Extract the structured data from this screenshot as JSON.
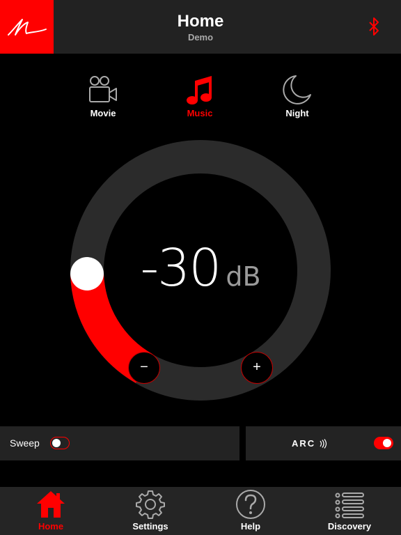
{
  "header": {
    "title": "Home",
    "subtitle": "Demo",
    "logo_icon": "signature-logo-icon",
    "bluetooth_icon": "bluetooth-icon"
  },
  "modes": [
    {
      "label": "Movie",
      "icon": "movie-camera-icon",
      "active": false
    },
    {
      "label": "Music",
      "icon": "music-note-icon",
      "active": true
    },
    {
      "label": "Night",
      "icon": "moon-icon",
      "active": false
    }
  ],
  "volume": {
    "value": "-30",
    "unit": "dB",
    "minus_label": "−",
    "plus_label": "+"
  },
  "toggles": {
    "sweep_label": "Sweep",
    "sweep_on": false,
    "arc_label": "ARC",
    "arc_on": true
  },
  "tabs": [
    {
      "label": "Home",
      "icon": "house-icon",
      "active": true
    },
    {
      "label": "Settings",
      "icon": "gear-icon",
      "active": false
    },
    {
      "label": "Help",
      "icon": "question-icon",
      "active": false
    },
    {
      "label": "Discovery",
      "icon": "list-icon",
      "active": false
    }
  ],
  "colors": {
    "accent": "#ff0000",
    "header_bg": "#222222",
    "background": "#000000",
    "panel_bg": "#232323",
    "dial_track": "#2b2b2b"
  }
}
